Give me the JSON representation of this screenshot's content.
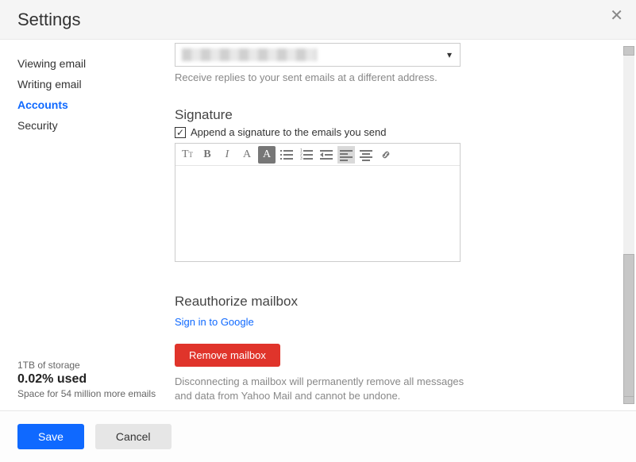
{
  "header": {
    "title": "Settings"
  },
  "sidebar": {
    "items": [
      {
        "label": "Viewing email"
      },
      {
        "label": "Writing email"
      },
      {
        "label": "Accounts"
      },
      {
        "label": "Security"
      }
    ]
  },
  "storage": {
    "total": "1TB of storage",
    "used_pct": "0.02% used",
    "remaining": "Space for 54 million more emails"
  },
  "reply": {
    "hint": "Receive replies to your sent emails at a different address."
  },
  "signature": {
    "title": "Signature",
    "checkbox_label": "Append a signature to the emails you send"
  },
  "reauth": {
    "title": "Reauthorize mailbox",
    "link": "Sign in to Google",
    "remove_btn": "Remove mailbox",
    "desc": "Disconnecting a mailbox will permanently remove all messages and data from Yahoo Mail and cannot be undone."
  },
  "footer": {
    "save": "Save",
    "cancel": "Cancel"
  }
}
